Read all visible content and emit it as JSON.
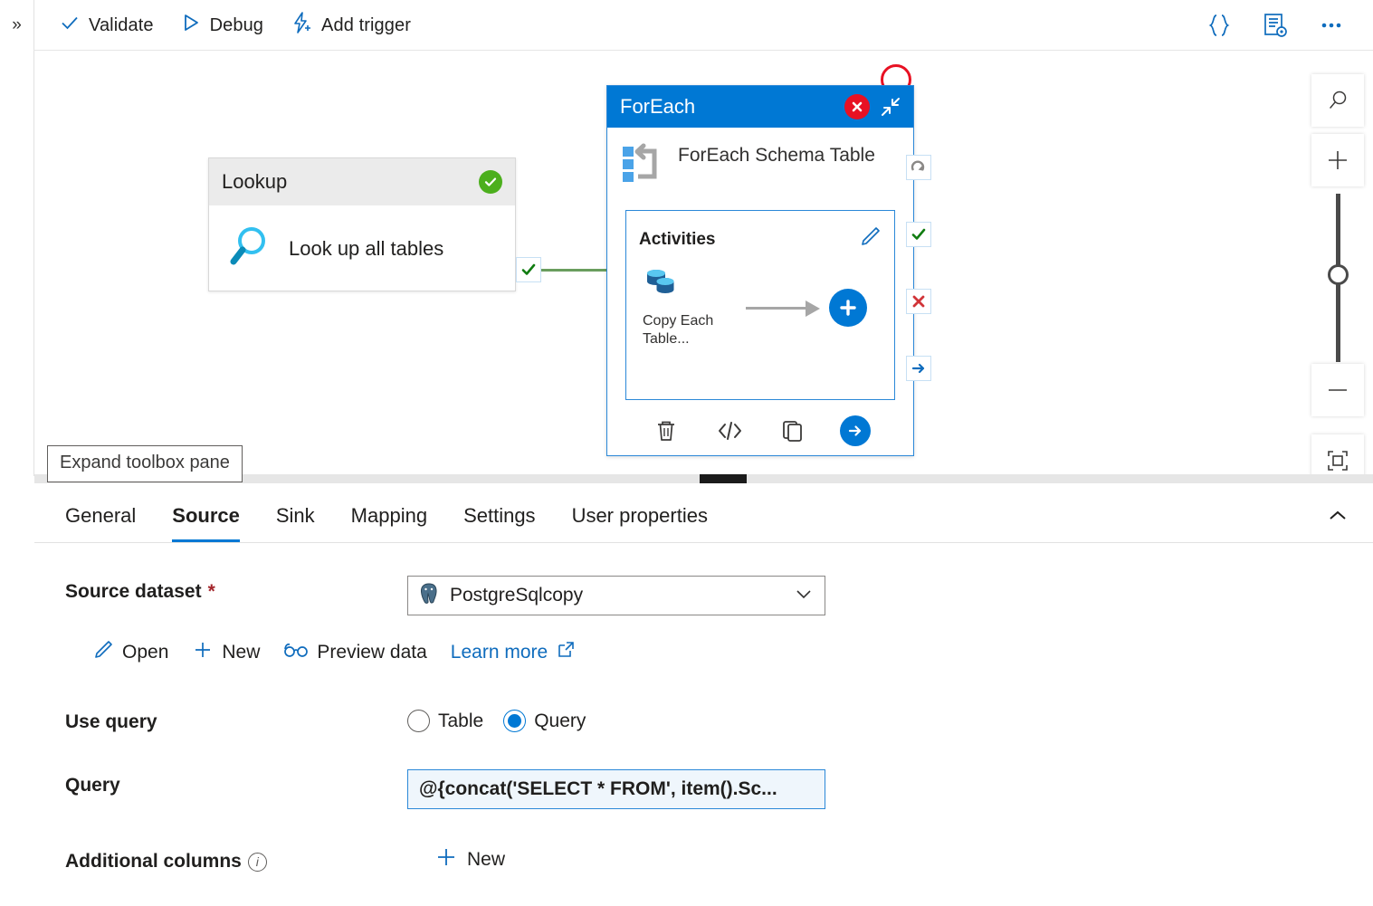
{
  "toolbar": {
    "expand_chevron": "»",
    "items": [
      {
        "label": "Validate",
        "icon": "check-icon"
      },
      {
        "label": "Debug",
        "icon": "play-triangle-icon"
      },
      {
        "label": "Add trigger",
        "icon": "lightning-plus-icon"
      }
    ],
    "right_icons": [
      {
        "name": "code-braces-icon",
        "glyph": "{}"
      },
      {
        "name": "properties-gear-icon",
        "glyph": "list-gear"
      },
      {
        "name": "more-ellipsis-icon",
        "glyph": "•••"
      }
    ]
  },
  "canvas": {
    "lookup_node": {
      "title": "Lookup",
      "name": "Look up all tables",
      "status": "success",
      "status_color": "#4caf1d",
      "icon": "magnifier-icon"
    },
    "connector": {
      "badge": "success-check",
      "line_color": "#6a9e5e"
    },
    "foreach_node": {
      "title": "ForEach",
      "name": "ForEach Schema Table",
      "header_color": "#0078d4",
      "delete_icon": "red-x-circle-icon",
      "collapse_icon": "collapse-diagonal-icon",
      "activities_label": "Activities",
      "edit_icon": "pencil-icon",
      "child_activity": {
        "label": "Copy Each Table...",
        "icon": "copy-data-icon"
      },
      "add_icon": "plus-circle-icon",
      "footer_icons": [
        {
          "name": "delete-trash-icon",
          "glyph": "trash"
        },
        {
          "name": "code-view-icon",
          "glyph": "</>"
        },
        {
          "name": "clone-copy-icon",
          "glyph": "clone"
        },
        {
          "name": "run-arrow-icon",
          "glyph": "arrow-right-circle"
        }
      ]
    },
    "dependency_badges": [
      {
        "name": "upon-completion-badge",
        "glyph": "loop",
        "color": "#8a8886"
      },
      {
        "name": "upon-success-badge",
        "glyph": "check",
        "color": "#107c10"
      },
      {
        "name": "upon-failure-badge",
        "glyph": "x",
        "color": "#d13438"
      },
      {
        "name": "upon-skip-badge",
        "glyph": "arrow",
        "color": "#0f6cbd"
      }
    ],
    "annotation_ring_color": "#e81123",
    "zoom_controls": [
      {
        "name": "zoom-search-icon"
      },
      {
        "name": "zoom-in-icon"
      },
      {
        "name": "zoom-slider"
      },
      {
        "name": "zoom-out-icon"
      },
      {
        "name": "zoom-fit-icon"
      }
    ]
  },
  "tooltip": {
    "expand_toolbox": "Expand toolbox pane"
  },
  "properties": {
    "tabs": [
      {
        "label": "General",
        "active": false
      },
      {
        "label": "Source",
        "active": true
      },
      {
        "label": "Sink",
        "active": false
      },
      {
        "label": "Mapping",
        "active": false
      },
      {
        "label": "Settings",
        "active": false
      },
      {
        "label": "User properties",
        "active": false
      }
    ],
    "collapse_icon": "chevron-up-icon",
    "source": {
      "dataset_label": "Source dataset",
      "dataset_required": "*",
      "dataset_value": "PostgreSqlcopy",
      "dataset_icon": "postgresql-elephant-icon",
      "links": [
        {
          "label": "Open",
          "icon": "pencil-icon",
          "style": "dark"
        },
        {
          "label": "New",
          "icon": "plus-icon",
          "style": "dark"
        },
        {
          "label": "Preview data",
          "icon": "glasses-icon",
          "style": "dark"
        },
        {
          "label": "Learn more",
          "icon": "external-link-icon",
          "style": "blue"
        }
      ],
      "use_query_label": "Use query",
      "use_query_options": [
        {
          "label": "Table",
          "selected": false
        },
        {
          "label": "Query",
          "selected": true
        }
      ],
      "query_label": "Query",
      "query_value": "@{concat('SELECT * FROM', item().Sc...",
      "additional_columns_label": "Additional columns",
      "additional_columns_info": "info-icon",
      "additional_columns_new": "New"
    }
  },
  "colors": {
    "accent": "#0078d4",
    "link": "#0f6cbd",
    "success": "#107c10",
    "error": "#e81123",
    "required": "#a4262c"
  }
}
